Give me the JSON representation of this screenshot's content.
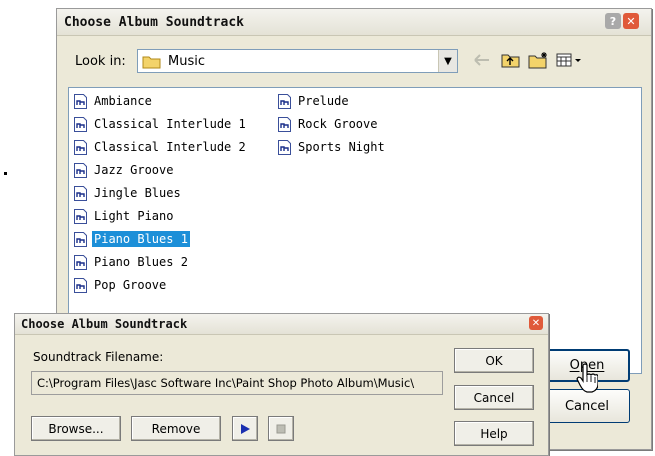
{
  "main_dialog": {
    "title": "Choose Album Soundtrack",
    "look_in_label": "Look in:",
    "look_in_value": "Music",
    "files": [
      {
        "name": "Ambiance",
        "selected": false
      },
      {
        "name": "Classical Interlude 1",
        "selected": false
      },
      {
        "name": "Classical Interlude 2",
        "selected": false
      },
      {
        "name": "Jazz Groove",
        "selected": false
      },
      {
        "name": "Jingle Blues",
        "selected": false
      },
      {
        "name": "Light Piano",
        "selected": false
      },
      {
        "name": "Piano Blues 1",
        "selected": true
      },
      {
        "name": "Piano Blues 2",
        "selected": false
      },
      {
        "name": "Pop Groove",
        "selected": false
      },
      {
        "name": "Prelude",
        "selected": false
      },
      {
        "name": "Rock Groove",
        "selected": false
      },
      {
        "name": "Sports Night",
        "selected": false
      }
    ],
    "open_button": "Open",
    "cancel_button": "Cancel"
  },
  "front_dialog": {
    "title": "Choose Album Soundtrack",
    "filename_label": "Soundtrack Filename:",
    "filename_value": "C:\\Program Files\\Jasc Software Inc\\Paint Shop Photo Album\\Music\\",
    "ok_button": "OK",
    "cancel_button": "Cancel",
    "help_button": "Help",
    "browse_button": "Browse...",
    "remove_button": "Remove"
  },
  "icons": {
    "help": "help-icon",
    "close": "close-icon",
    "folder": "folder-icon",
    "back": "back-arrow-icon",
    "up_folder": "up-folder-icon",
    "new_folder": "new-folder-icon",
    "view_menu": "view-menu-icon",
    "audio_file": "audio-file-icon",
    "play": "play-icon",
    "stop": "stop-icon",
    "cursor": "hand-cursor-icon"
  },
  "colors": {
    "selection": "#1c8fd8",
    "close_red": "#e05a3a",
    "help_gray": "#a9a9a9",
    "dialog_bg": "#ece9d8"
  }
}
